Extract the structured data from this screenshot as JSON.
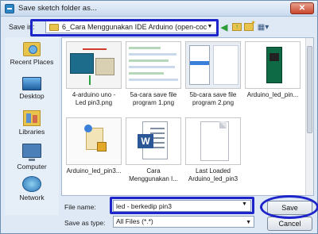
{
  "window": {
    "title": "Save sketch folder as...",
    "close_label": "✕"
  },
  "location": {
    "label": "Save in:",
    "value": "6_Cara Menggunakan IDE Arduino (open-coc"
  },
  "toolbar": {
    "back_icon": "back-arrow-icon",
    "up_icon": "up-folder-icon",
    "new_folder_icon": "new-folder-icon",
    "views_icon": "views-menu-icon"
  },
  "places": [
    {
      "label": "Recent Places",
      "icon": "recent-places-icon"
    },
    {
      "label": "Desktop",
      "icon": "desktop-icon"
    },
    {
      "label": "Libraries",
      "icon": "libraries-icon"
    },
    {
      "label": "Computer",
      "icon": "computer-icon"
    },
    {
      "label": "Network",
      "icon": "network-icon"
    }
  ],
  "files": [
    {
      "name_line1": "4-arduino uno -",
      "name_line2": "Led pin3.png"
    },
    {
      "name_line1": "5a-cara save file",
      "name_line2": "program 1.png"
    },
    {
      "name_line1": "5b-cara save file",
      "name_line2": "program 2.png"
    },
    {
      "name_line1": "Arduino_led_pin...",
      "name_line2": ""
    },
    {
      "name_line1": "Arduino_led_pin3...",
      "name_line2": ""
    },
    {
      "name_line1": "Cara",
      "name_line2": "Menggunakan I..."
    },
    {
      "name_line1": "Last Loaded",
      "name_line2": "Arduino_led_pin3"
    }
  ],
  "filename": {
    "label": "File name:",
    "value": "led - berkedip pin3"
  },
  "filetype": {
    "label": "Save as type:",
    "value": "All Files (*.*)"
  },
  "buttons": {
    "save": "Save",
    "cancel": "Cancel"
  },
  "colors": {
    "highlight": "#1d24c9",
    "accent": "#2b84c4"
  }
}
